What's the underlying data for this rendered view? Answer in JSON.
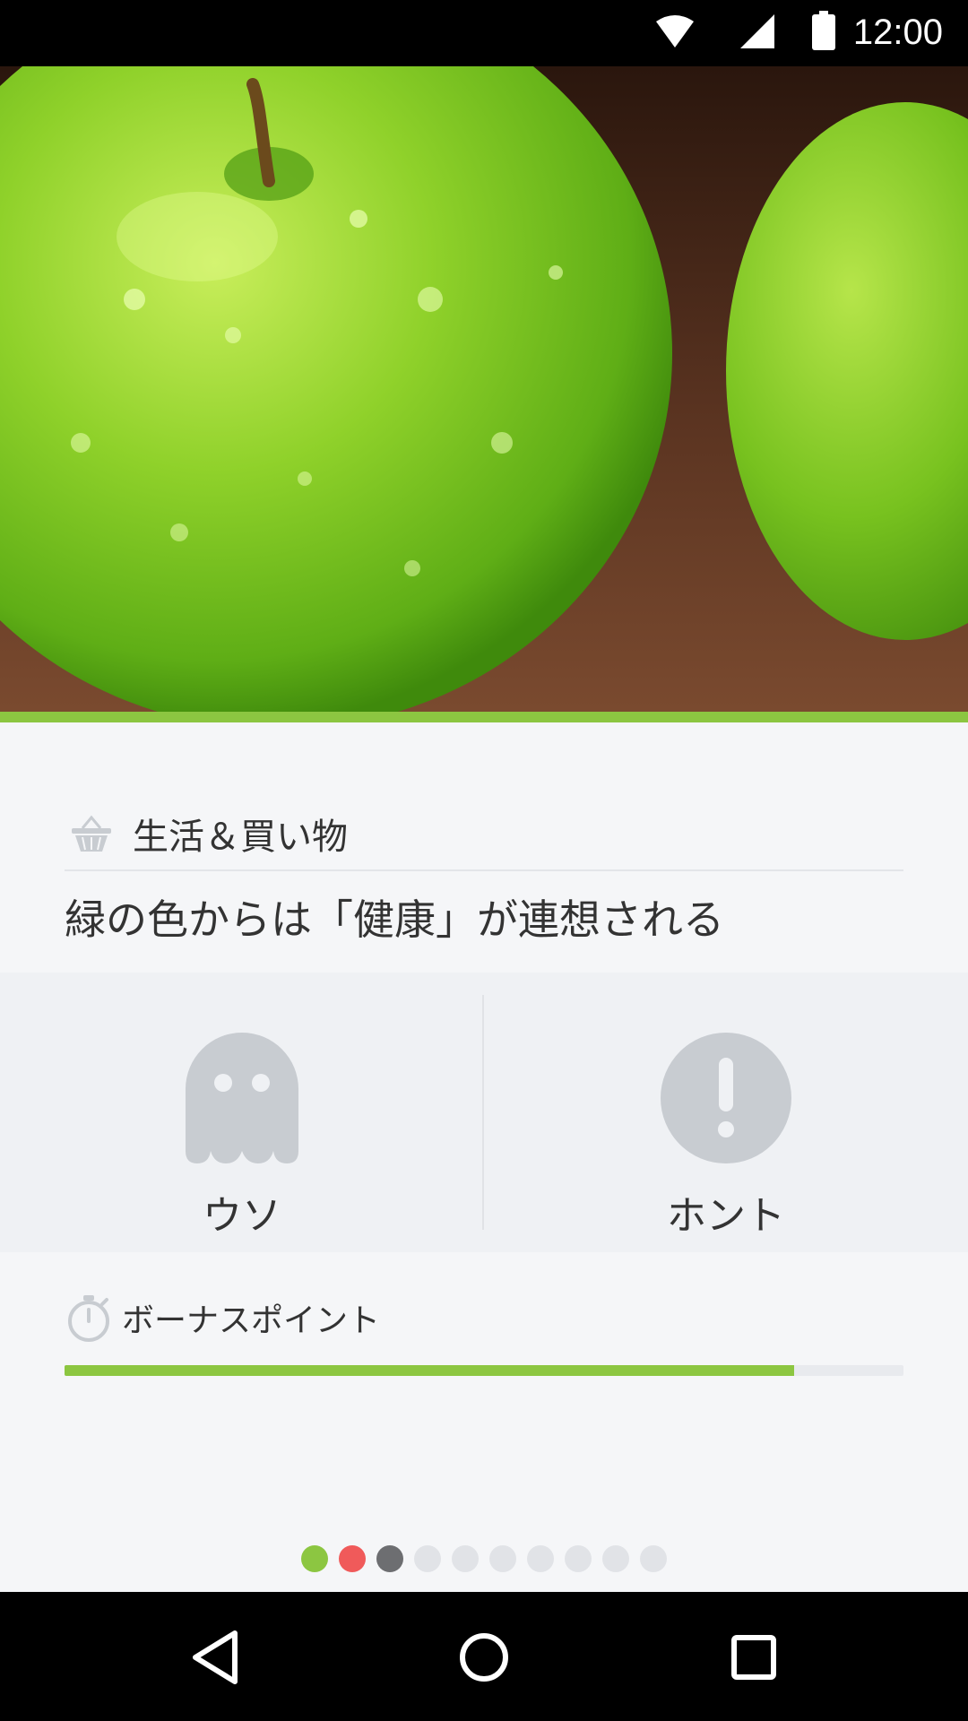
{
  "status_bar": {
    "time": "12:00",
    "icons": [
      "wifi-icon",
      "cell-signal-icon",
      "battery-icon"
    ]
  },
  "hero": {
    "image": "green-apples-photo"
  },
  "quiz": {
    "category": "生活＆買い物",
    "category_icon": "basket-icon",
    "question": "緑の色からは「健康」が連想される",
    "answers": [
      {
        "label": "ウソ",
        "icon": "ghost-icon"
      },
      {
        "label": "ホント",
        "icon": "exclamation-icon"
      }
    ]
  },
  "bonus": {
    "label": "ボーナスポイント",
    "icon": "stopwatch-icon",
    "progress": 0.87
  },
  "pager": {
    "dots": [
      "#8cc641",
      "#f05a5a",
      "#6d6e71",
      "#e1e3e7",
      "#e1e3e7",
      "#e1e3e7",
      "#e1e3e7",
      "#e1e3e7",
      "#e1e3e7",
      "#e1e3e7"
    ]
  },
  "colors": {
    "accent": "#8cc641",
    "icon_gray": "#c8ccd1"
  },
  "nav_bar": {
    "buttons": [
      "back-icon",
      "home-icon",
      "recents-icon"
    ]
  }
}
